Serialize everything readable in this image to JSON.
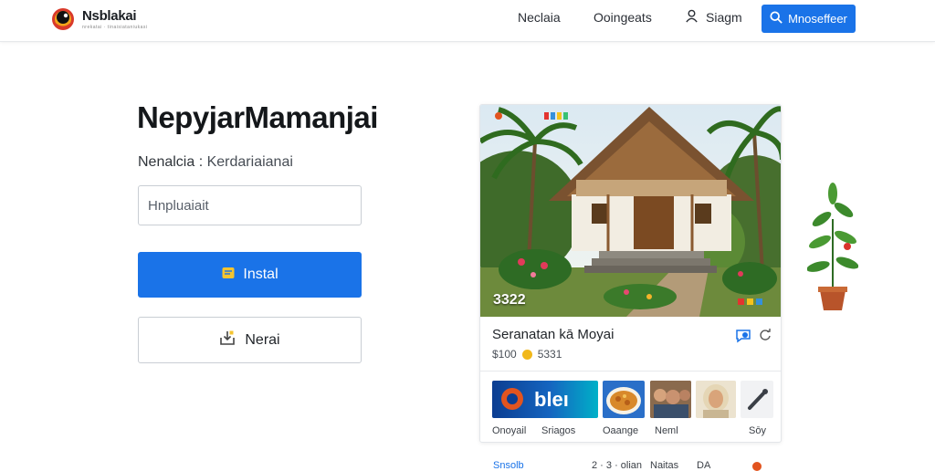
{
  "header": {
    "logo_text": "Nsblakai",
    "logo_subtext": "nrekatai · tinaisiataniukasi",
    "nav": [
      "Neclaia",
      "Ooingeats"
    ],
    "signin_label": "Siagm",
    "cta_label": "Mnoseffeer"
  },
  "hero": {
    "title": "NepyjarMamanjai",
    "subtitle_prefix": "Nenalcia :",
    "subtitle_value": "Kerdariaianai",
    "input_placeholder": "Hnpluaiait",
    "primary_label": "Instal",
    "secondary_label": "Nerai"
  },
  "card": {
    "photo_tag": "3322",
    "title": "Seranatan kā Moyai",
    "meta_price": "$100",
    "meta_rating": "5331",
    "thumbs": [
      {
        "label": "Onoyail",
        "text": "bleı"
      },
      {
        "label": "Sriagos"
      },
      {
        "label": "Oaange"
      },
      {
        "label": "Neml"
      },
      {
        "label": "Sōy"
      }
    ]
  },
  "below_strip": [
    "Snsolb",
    "2 · 3 · olian",
    "Naitas",
    "DA"
  ]
}
